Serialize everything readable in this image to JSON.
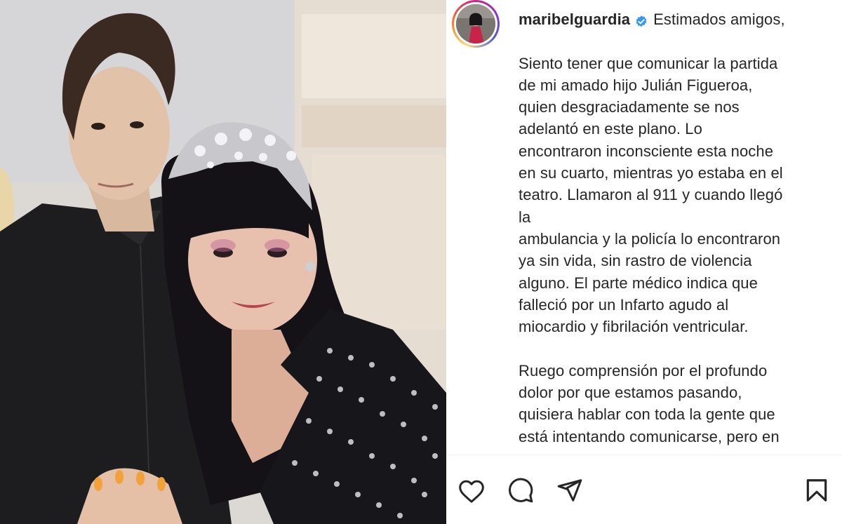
{
  "post": {
    "username": "maribelguardia",
    "verified": true,
    "caption_lines": [
      [
        "Estimados amigos,"
      ],
      [],
      [
        "Siento tener que comunicar la partida",
        "de mi amado hijo Julián Figueroa,",
        "quien desgraciadamente se nos",
        "adelantó en este plano. Lo",
        "encontraron inconsciente esta noche",
        "en su cuarto, mientras yo estaba en el",
        "teatro. Llamaron al 911 y cuando llegó",
        "la",
        "ambulancia y la policía lo encontraron",
        "ya sin vida, sin rastro de violencia",
        "alguno. El parte médico indica que",
        "falleció por un Infarto agudo al",
        "miocardio y fibrilación ventricular."
      ],
      [
        "Ruego comprensión por el profundo",
        "dolor por que estamos pasando,",
        "quisiera hablar con toda la gente que",
        "está intentando comunicarse, pero en"
      ]
    ]
  },
  "actions": {
    "like_icon": "heart-icon",
    "comment_icon": "comment-icon",
    "share_icon": "paper-plane-icon",
    "save_icon": "bookmark-icon"
  },
  "colors": {
    "text": "#262626",
    "verified_badge": "#3897f0",
    "ring_start": "#feda75",
    "ring_mid": "#d62976",
    "ring_end": "#4f5bd5"
  }
}
